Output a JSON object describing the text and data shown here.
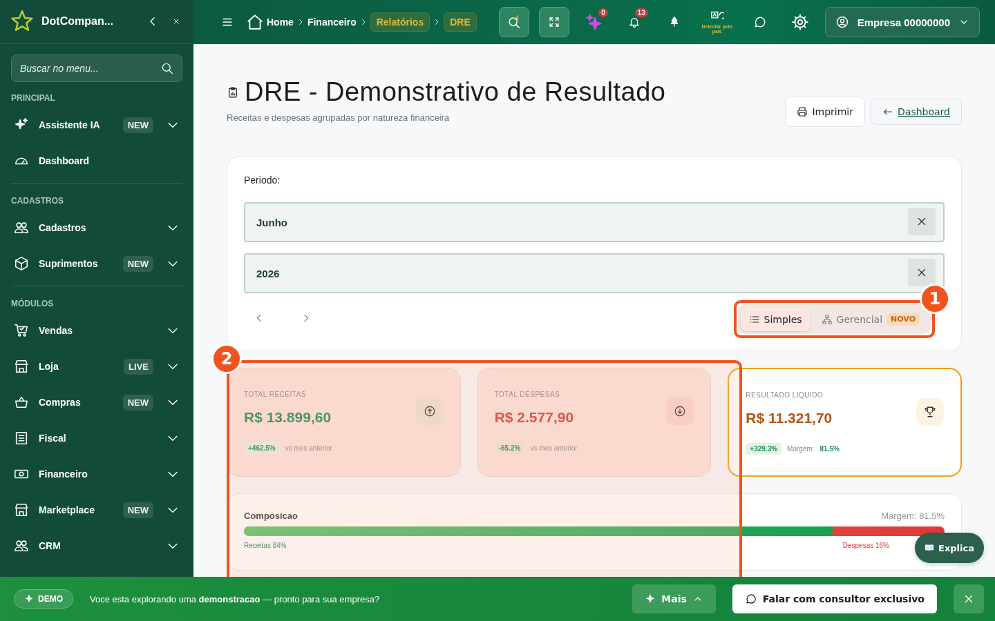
{
  "brand": {
    "name": "DotCompan..."
  },
  "sidebar": {
    "search": {
      "placeholder": "Buscar no menu..."
    },
    "sections": [
      {
        "title": "PRINCIPAL",
        "items": [
          {
            "label": "Assistente IA",
            "badge": "NEW",
            "has_submenu": true
          },
          {
            "label": "Dashboard",
            "has_submenu": false
          }
        ]
      },
      {
        "title": "CADASTROS",
        "items": [
          {
            "label": "Cadastros",
            "has_submenu": true
          },
          {
            "label": "Suprimentos",
            "badge": "NEW",
            "has_submenu": true
          }
        ]
      },
      {
        "title": "MÓDULOS",
        "items": [
          {
            "label": "Vendas",
            "has_submenu": true
          },
          {
            "label": "Loja",
            "badge": "LIVE",
            "has_submenu": true
          },
          {
            "label": "Compras",
            "badge": "NEW",
            "has_submenu": true
          },
          {
            "label": "Fiscal",
            "has_submenu": true
          },
          {
            "label": "Financeiro",
            "has_submenu": true
          },
          {
            "label": "Marketplace",
            "badge": "NEW",
            "has_submenu": true
          },
          {
            "label": "CRM",
            "has_submenu": true
          }
        ]
      }
    ]
  },
  "breadcrumb": [
    {
      "label": "Home",
      "kind": "plain"
    },
    {
      "label": "Financeiro",
      "kind": "plain"
    },
    {
      "label": "Relatórios",
      "kind": "chip"
    },
    {
      "label": "DRE",
      "kind": "chip"
    }
  ],
  "header_badges": {
    "assistant": "0",
    "notifications": "13"
  },
  "language_hint": "Detectar pelo pais",
  "company": {
    "label": "Empresa 00000000"
  },
  "page": {
    "title": "DRE - Demonstrativo de Resultado",
    "subtitle": "Receitas e despesas agrupadas por natureza financeira",
    "actions": [
      {
        "label": "Imprimir",
        "kind": "button"
      },
      {
        "label": "Dashboard",
        "kind": "link"
      }
    ]
  },
  "period": {
    "label": "Periodo:",
    "fields": [
      {
        "value": "Junho"
      },
      {
        "value": "2026"
      }
    ]
  },
  "modes": [
    {
      "label": "Simples",
      "selected": true
    },
    {
      "label": "Gerencial",
      "badge": "NOVO",
      "selected": false
    }
  ],
  "stats": [
    {
      "label": "TOTAL RECEITAS",
      "value": "R$ 13.899,60",
      "kind": "income",
      "change": "+462.5%",
      "note": "vs mes anterior"
    },
    {
      "label": "TOTAL DESPESAS",
      "value": "R$ 2.577,90",
      "kind": "expense",
      "change": "-65.2%",
      "note": "vs mes anterior"
    },
    {
      "label": "RESULTADO LIQUIDO",
      "value": "R$ 11.321,70",
      "kind": "result",
      "change": "+329.3%",
      "note": "Margem:",
      "note_value": "81.5%"
    }
  ],
  "composition": {
    "title": "Composicao",
    "margin": "Margem: 81.5%",
    "level": 0.84,
    "income_label": "Receitas 84%",
    "expense_label": "Despesas 16%"
  },
  "tour": [
    {
      "number": "1"
    },
    {
      "number": "2"
    }
  ],
  "help_button": {
    "label": "Explica"
  },
  "banner": {
    "badge": "DEMO",
    "text": "Voce esta explorando uma **demonstracao** — pronto para sua empresa?",
    "more": "Mais",
    "cta": "Falar com consultor exclusivo"
  }
}
